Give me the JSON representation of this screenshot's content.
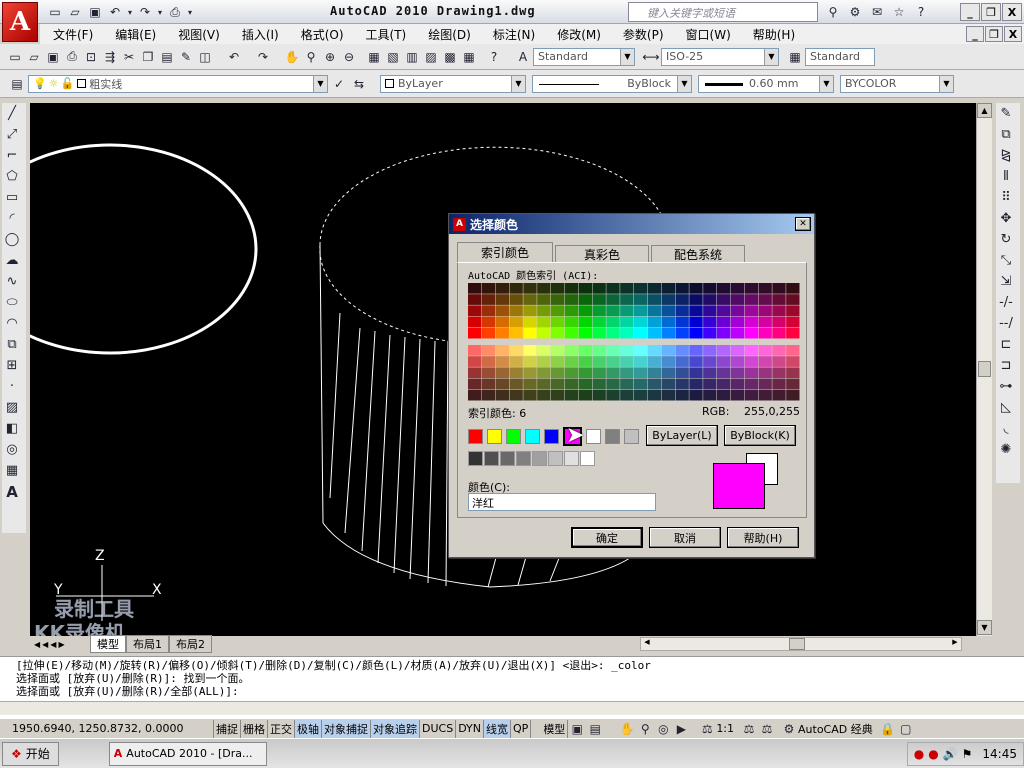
{
  "app": {
    "title": "AutoCAD 2010   Drawing1.dwg",
    "logo_letter": "A",
    "search_placeholder": "键入关键字或短语"
  },
  "window_controls": {
    "minimize": "_",
    "restore": "❐",
    "close": "X"
  },
  "menu": [
    "文件(F)",
    "编辑(E)",
    "视图(V)",
    "插入(I)",
    "格式(O)",
    "工具(T)",
    "绘图(D)",
    "标注(N)",
    "修改(M)",
    "参数(P)",
    "窗口(W)",
    "帮助(H)"
  ],
  "styles_toolbar": {
    "text_style": "Standard",
    "dim_style": "ISO-25",
    "table_style": "Standard"
  },
  "layers_toolbar": {
    "layer": "粗实线",
    "color": "ByLayer",
    "linetype": "ByBlock",
    "lineweight": "0.60 mm",
    "plotstyle": "BYCOLOR"
  },
  "ucs": {
    "x": "X",
    "y": "Y",
    "z": "Z"
  },
  "watermark": [
    "录制工具",
    "KK录像机"
  ],
  "layout_tabs": [
    "模型",
    "布局1",
    "布局2"
  ],
  "dialog": {
    "title": "选择颜色",
    "close": "✕",
    "tabs": [
      "索引颜色",
      "真彩色",
      "配色系统"
    ],
    "aci_label": "AutoCAD 颜色索引 (ACI):",
    "index_label": "索引颜色: 6",
    "rgb_label": "RGB:",
    "rgb_value": "255,0,255",
    "bylayer_button": "ByLayer(L)",
    "byblock_button": "ByBlock(K)",
    "color_label": "颜色(C):",
    "color_value": "洋红",
    "ok_button": "确定",
    "cancel_button": "取消",
    "help_button": "帮助(H)",
    "selected_color": "#ff00ff",
    "previous_color": "#ffffff",
    "standard_colors": [
      "#ff0000",
      "#ffff00",
      "#00ff00",
      "#00ffff",
      "#0000ff",
      "#ff00ff",
      "#ffffff",
      "#808080",
      "#c0c0c0"
    ],
    "gray_colors": [
      "#333333",
      "#505050",
      "#696969",
      "#808080",
      "#a0a0a0",
      "#c0c0c0",
      "#e0e0e0",
      "#ffffff"
    ]
  },
  "command_lines": [
    "[拉伸(E)/移动(M)/旋转(R)/偏移(O)/倾斜(T)/删除(D)/复制(C)/颜色(L)/材质(A)/放弃(U)/退出(X)] <退出>: _color",
    "选择面或 [放弃(U)/删除(R)]: 找到一个面。",
    "选择面或 [放弃(U)/删除(R)/全部(ALL)]:"
  ],
  "status_bar": {
    "coords": "1950.6940, 1250.8732, 0.0000",
    "toggles": [
      "捕捉",
      "栅格",
      "正交",
      "极轴",
      "对象捕捉",
      "对象追踪",
      "DUCS",
      "DYN",
      "线宽",
      "QP"
    ],
    "model": "模型",
    "scale": "1:1",
    "workspace": "AutoCAD 经典"
  },
  "taskbar": {
    "start": "开始",
    "task": "AutoCAD 2010 - [Dra...",
    "time": "14:45"
  }
}
